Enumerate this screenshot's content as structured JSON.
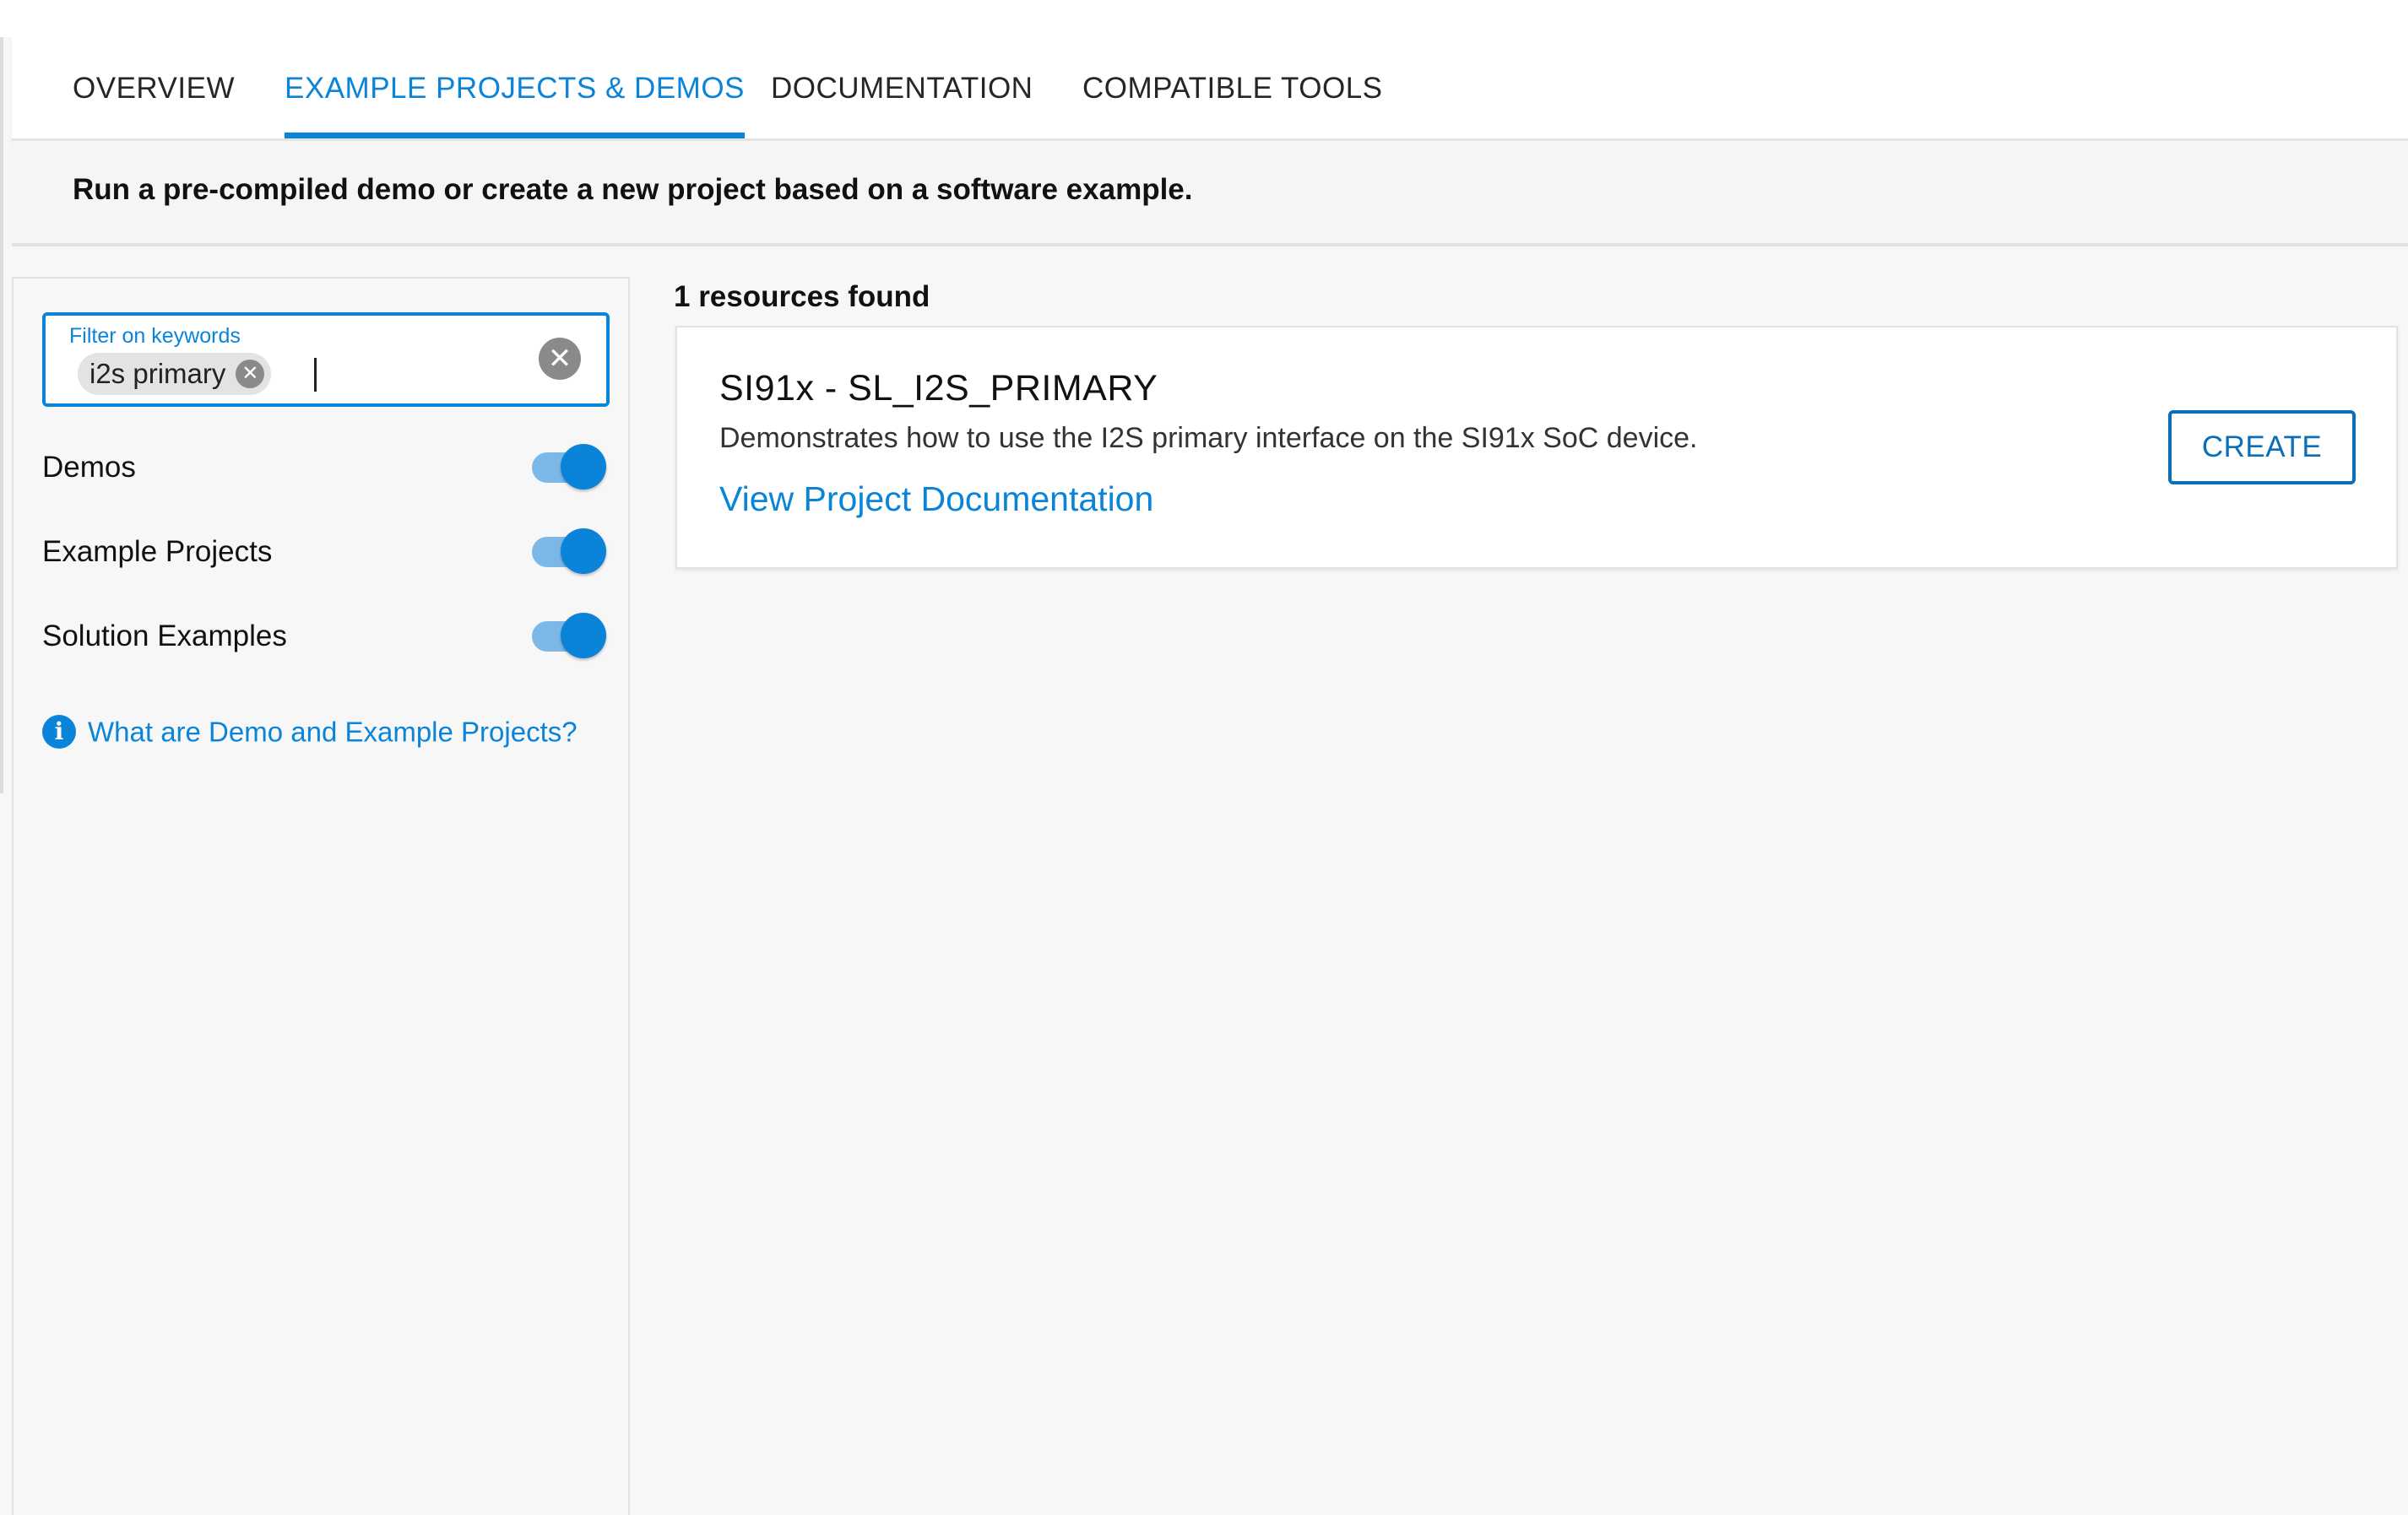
{
  "tabs": [
    {
      "label": "OVERVIEW",
      "active": false
    },
    {
      "label": "EXAMPLE PROJECTS & DEMOS",
      "active": true
    },
    {
      "label": "DOCUMENTATION",
      "active": false
    },
    {
      "label": "COMPATIBLE TOOLS",
      "active": false
    }
  ],
  "subheader": "Run a pre-compiled demo or create a new project based on a software example.",
  "filter": {
    "label": "Filter on keywords",
    "chip": "i2s primary"
  },
  "toggles": [
    {
      "label": "Demos",
      "on": true
    },
    {
      "label": "Example Projects",
      "on": true
    },
    {
      "label": "Solution Examples",
      "on": true
    }
  ],
  "help_link": "What are Demo and Example Projects?",
  "results_count": "1 resources found",
  "card": {
    "title": "SI91x - SL_I2S_PRIMARY",
    "description": "Demonstrates how to use the I2S primary interface on the SI91x SoC device.",
    "link": "View Project Documentation",
    "button": "CREATE"
  },
  "colors": {
    "accent": "#0a84d8",
    "button_border": "#0a6fb8",
    "background": "#f7f7f7"
  }
}
